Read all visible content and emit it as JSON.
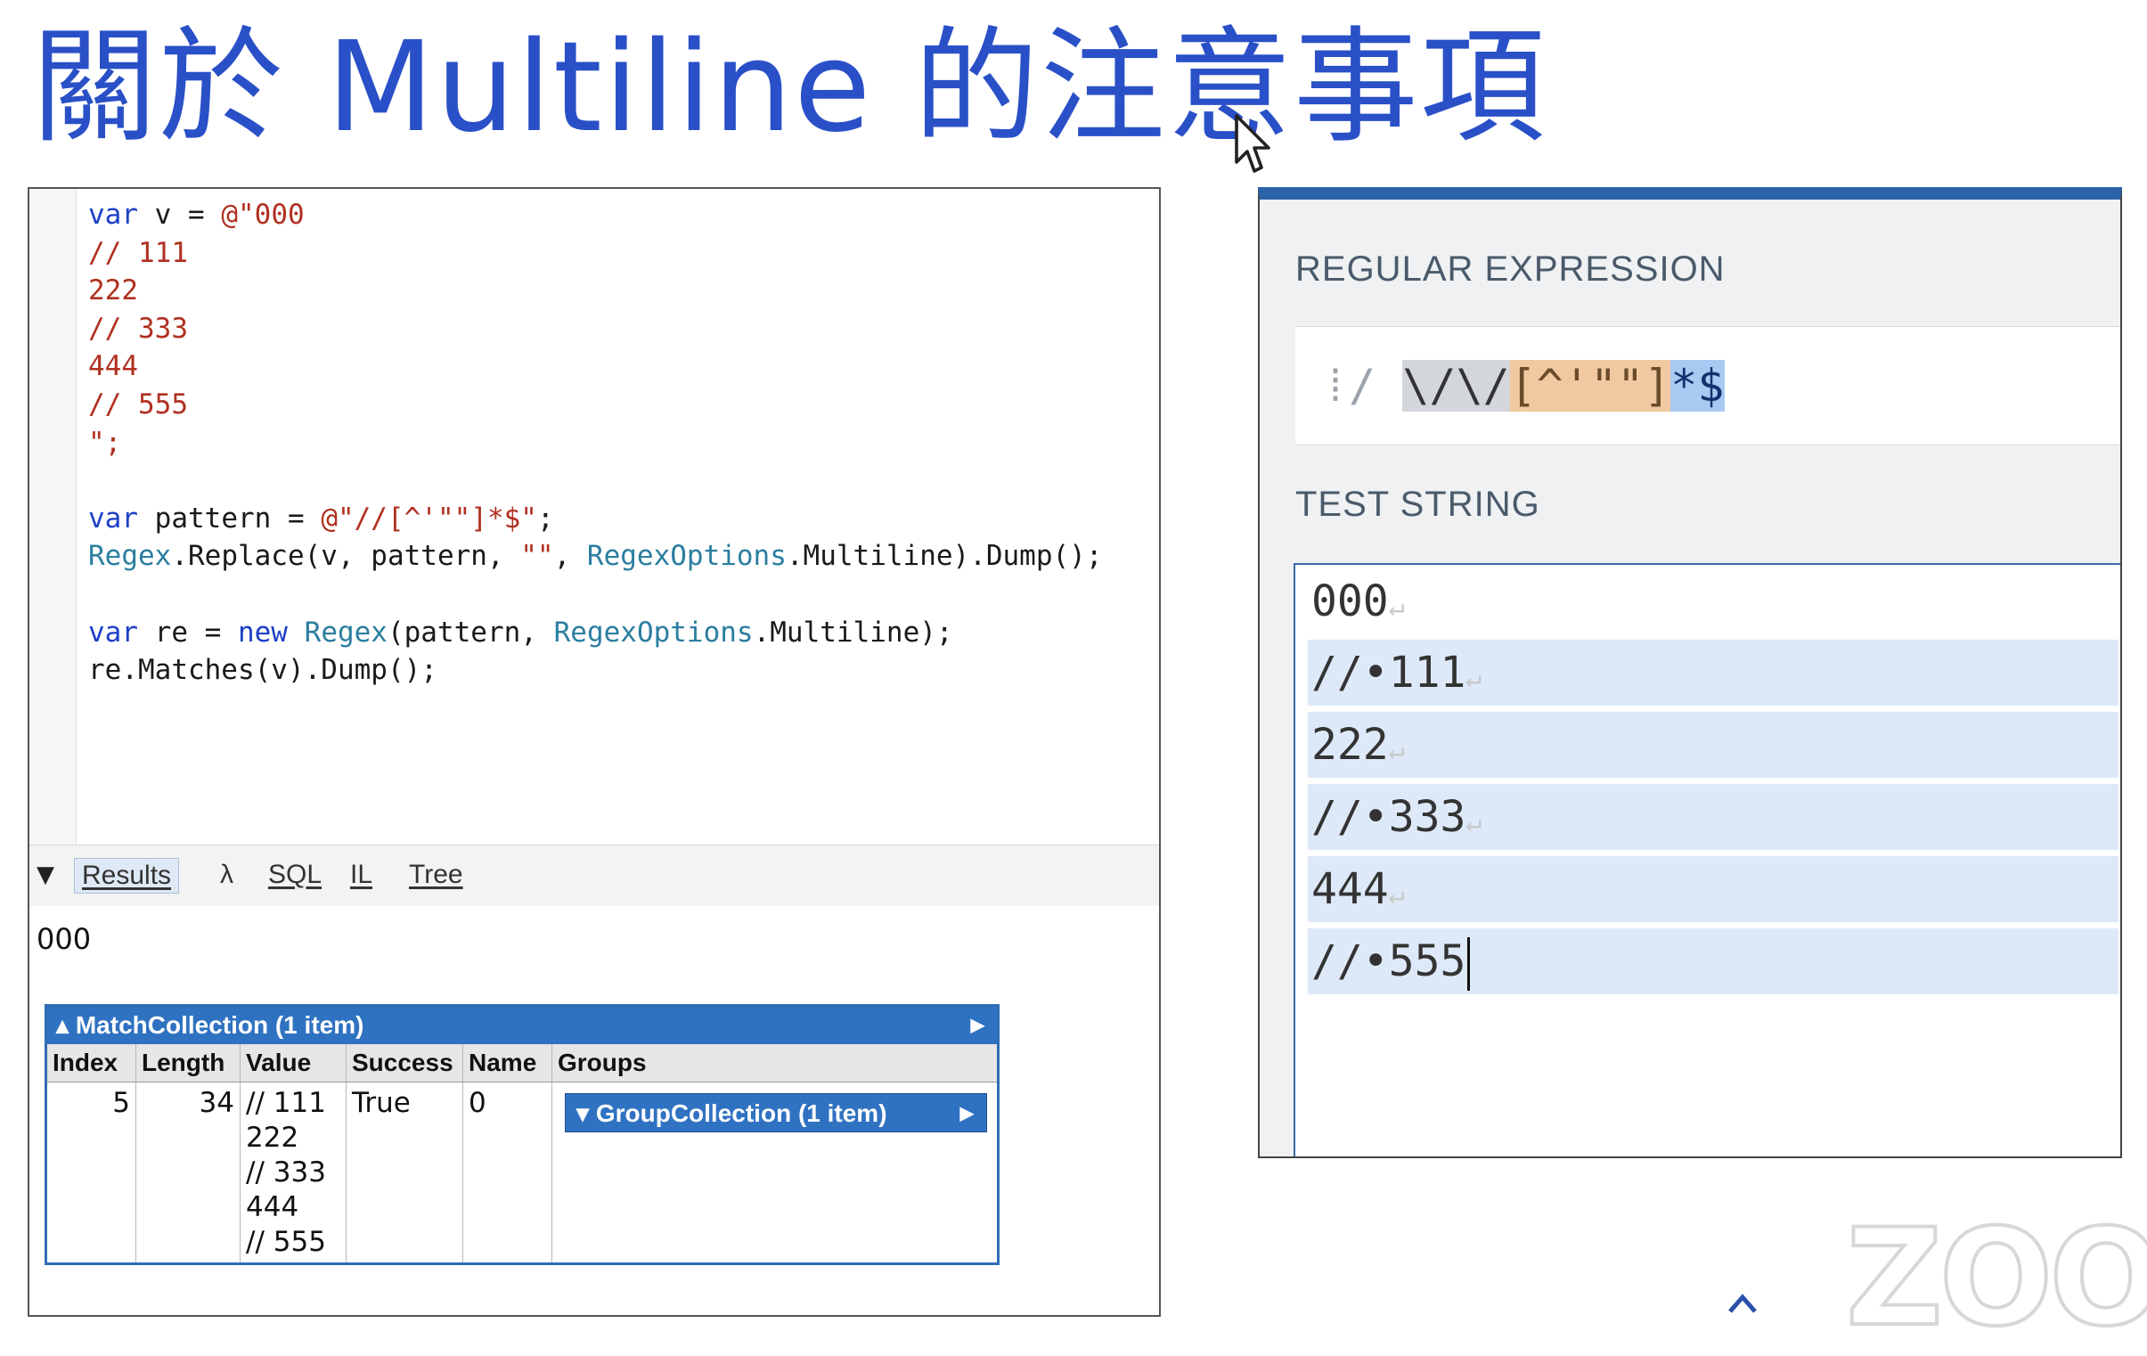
{
  "title": "關於 Multiline 的注意事項",
  "code_lines": [
    [
      {
        "t": "var",
        "c": "k"
      },
      {
        "t": " v = "
      },
      {
        "t": "@\"000",
        "c": "s"
      }
    ],
    [
      {
        "t": "// 111",
        "c": "s"
      }
    ],
    [
      {
        "t": "222",
        "c": "s"
      }
    ],
    [
      {
        "t": "// 333",
        "c": "s"
      }
    ],
    [
      {
        "t": "444",
        "c": "s"
      }
    ],
    [
      {
        "t": "// 555",
        "c": "s"
      }
    ],
    [
      {
        "t": "\";",
        "c": "s"
      }
    ],
    [],
    [
      {
        "t": "var",
        "c": "k"
      },
      {
        "t": " pattern = "
      },
      {
        "t": "@\"//[^'\"\"]*$\"",
        "c": "s"
      },
      {
        "t": ";"
      }
    ],
    [
      {
        "t": "Regex",
        "c": "t"
      },
      {
        "t": ".Replace(v, pattern, "
      },
      {
        "t": "\"\"",
        "c": "s"
      },
      {
        "t": ", "
      },
      {
        "t": "RegexOptions",
        "c": "t"
      },
      {
        "t": ".Multiline).Dump();"
      }
    ],
    [],
    [
      {
        "t": "var",
        "c": "k"
      },
      {
        "t": " re = "
      },
      {
        "t": "new",
        "c": "k"
      },
      {
        "t": " "
      },
      {
        "t": "Regex",
        "c": "t"
      },
      {
        "t": "(pattern, "
      },
      {
        "t": "RegexOptions",
        "c": "t"
      },
      {
        "t": ".Multiline);"
      }
    ],
    [
      {
        "t": "re.Matches(v).Dump();"
      }
    ]
  ],
  "tabs": {
    "results": "Results",
    "lambda": "λ",
    "sql": "SQL",
    "il": "IL",
    "tree": "Tree"
  },
  "results": {
    "dump_text": "000",
    "match_collection": {
      "header": "MatchCollection (1 item)",
      "columns": [
        "Index",
        "Length",
        "Value",
        "Success",
        "Name",
        "Groups"
      ],
      "row": {
        "index": "5",
        "length": "34",
        "value": "// 111\n222\n// 333\n444\n// 555",
        "success": "True",
        "name": "0",
        "groups_button": "GroupCollection (1 item)"
      }
    }
  },
  "regex_tester": {
    "regex_label": "REGULAR EXPRESSION",
    "regex_delim": "/",
    "regex_escapes": "\\/\\/",
    "regex_set": "[^'\"\"]",
    "regex_quant": "*$",
    "test_label": "TEST STRING",
    "test_lines": [
      "000",
      "//•111",
      "222",
      "//•333",
      "444",
      "//•555"
    ],
    "newline_mark": "↵"
  },
  "watermark": "ZOO",
  "colors": {
    "title": "#2a50c8",
    "keyword": "#1c3fc8",
    "string": "#b03020",
    "type": "#2b7ea0",
    "match_highlight": "#dde9f8",
    "header_blue": "#2f72c1"
  },
  "icons": [
    "cursor-arrow-icon",
    "collapse-triangle-icon",
    "expand-arrow-icon",
    "drag-handle-icon",
    "up-chevron-icon"
  ]
}
